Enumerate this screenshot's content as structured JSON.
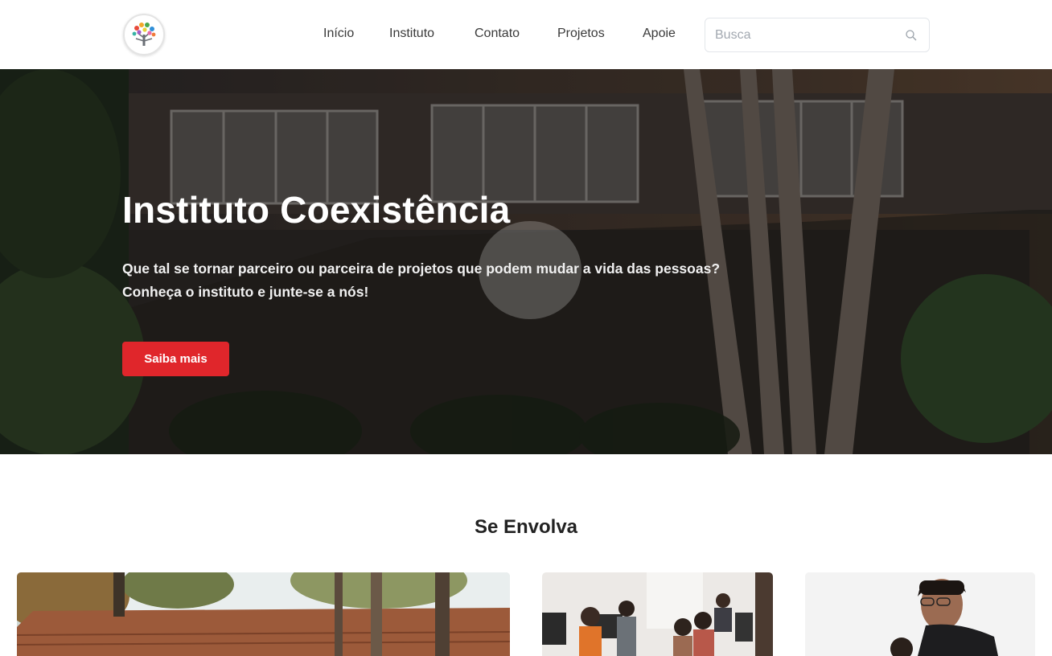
{
  "header": {
    "logo_name": "instituto-coexistencia-logo",
    "nav": [
      {
        "label": "Início"
      },
      {
        "label": "Instituto"
      },
      {
        "label": "Contato"
      },
      {
        "label": "Projetos"
      },
      {
        "label": "Apoie"
      }
    ],
    "search": {
      "placeholder": "Busca",
      "value": "",
      "icon": "search-icon"
    }
  },
  "hero": {
    "title": "Instituto Coexistência",
    "subtitle_line1": "Que tal se tornar parceiro ou parceira de projetos que podem mudar a vida das pessoas?",
    "subtitle_line2": "Conheça o instituto e junte-se a nós!",
    "button_label": "Saiba mais",
    "button_color": "#e0262b"
  },
  "involve": {
    "title_light": "Se",
    "title_bold": "Envolva",
    "cards": [
      {
        "image": "house-with-tiled-roof-and-trees"
      },
      {
        "image": "children-at-computer-lab"
      },
      {
        "image": "young-man-with-glasses"
      }
    ]
  }
}
